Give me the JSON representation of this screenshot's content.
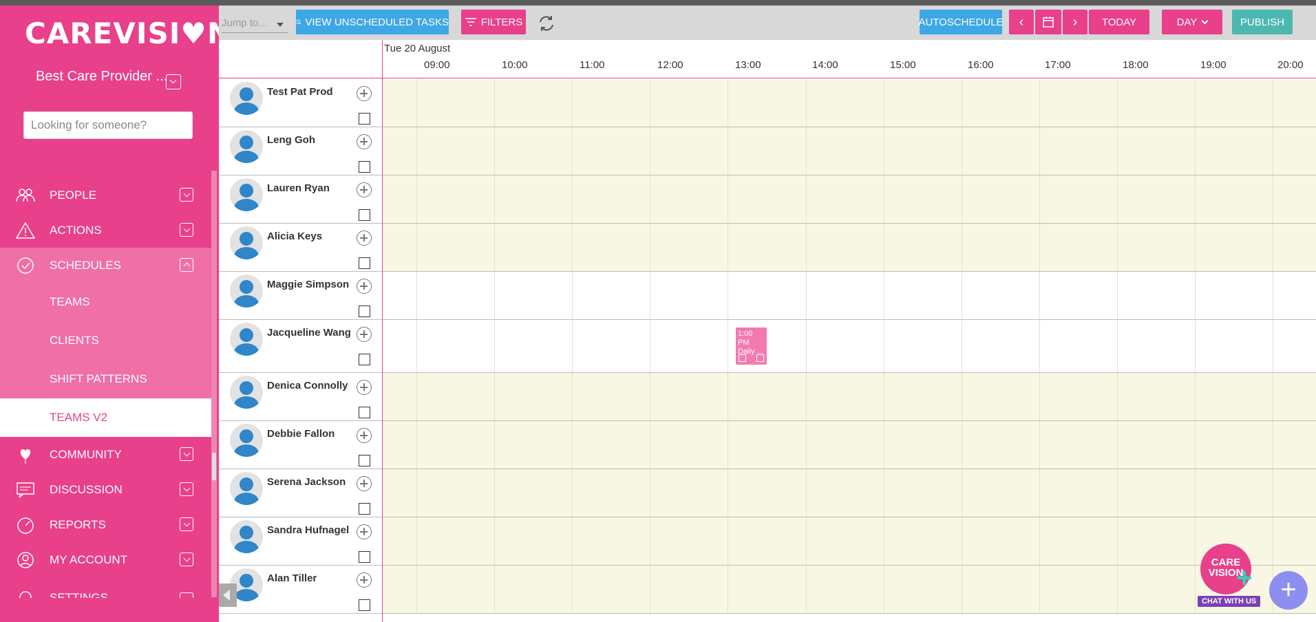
{
  "sidebar": {
    "logo_part1": "CAREVISI",
    "logo_heart": "♥",
    "logo_part2": "N",
    "provider": "Best Care Provider ...",
    "search_placeholder": "Looking for someone?",
    "items": [
      {
        "label": "PEOPLE",
        "icon": "people-icon"
      },
      {
        "label": "ACTIONS",
        "icon": "warning-icon"
      },
      {
        "label": "SCHEDULES",
        "icon": "schedule-icon"
      },
      {
        "label": "COMMUNITY",
        "icon": "heart-balloon-icon"
      },
      {
        "label": "DISCUSSION",
        "icon": "chat-icon"
      },
      {
        "label": "REPORTS",
        "icon": "speedometer-icon"
      },
      {
        "label": "MY ACCOUNT",
        "icon": "user-icon"
      },
      {
        "label": "SETTINGS",
        "icon": "gear-icon"
      }
    ],
    "schedule_subitems": [
      "TEAMS",
      "CLIENTS",
      "SHIFT PATTERNS",
      "TEAMS V2"
    ],
    "selected_subitem": "TEAMS V2"
  },
  "toolbar": {
    "jump_placeholder": "Jump to...",
    "view_unscheduled": "VIEW UNSCHEDULED TASKS",
    "filters": "FILTERS",
    "autoschedule": "AUTOSCHEDULE",
    "today": "TODAY",
    "view_mode": "DAY",
    "publish": "PUBLISH"
  },
  "schedule": {
    "date": "Tue 20 August",
    "hours": [
      "09:00",
      "10:00",
      "11:00",
      "12:00",
      "13:00",
      "14:00",
      "15:00",
      "16:00",
      "17:00",
      "18:00",
      "19:00",
      "20:00"
    ],
    "people": [
      {
        "name": "Test Pat Prod",
        "white": false
      },
      {
        "name": "Leng Goh",
        "white": false
      },
      {
        "name": "Lauren Ryan",
        "white": false
      },
      {
        "name": "Alicia Keys",
        "white": false
      },
      {
        "name": "Maggie Simpson",
        "white": true
      },
      {
        "name": "Jacqueline Wang",
        "white": true
      },
      {
        "name": "Denica Connolly",
        "white": false
      },
      {
        "name": "Debbie Fallon",
        "white": false
      },
      {
        "name": "Serena Jackson",
        "white": false
      },
      {
        "name": "Sandra Hufnagel",
        "white": false
      },
      {
        "name": "Alan Tiller",
        "white": false
      }
    ],
    "event": {
      "time": "1:00 PM",
      "title": "Daily ..."
    }
  },
  "chat": {
    "line1": "CARE",
    "line2": "VISION",
    "label": "CHAT WITH US"
  },
  "fab": "+"
}
